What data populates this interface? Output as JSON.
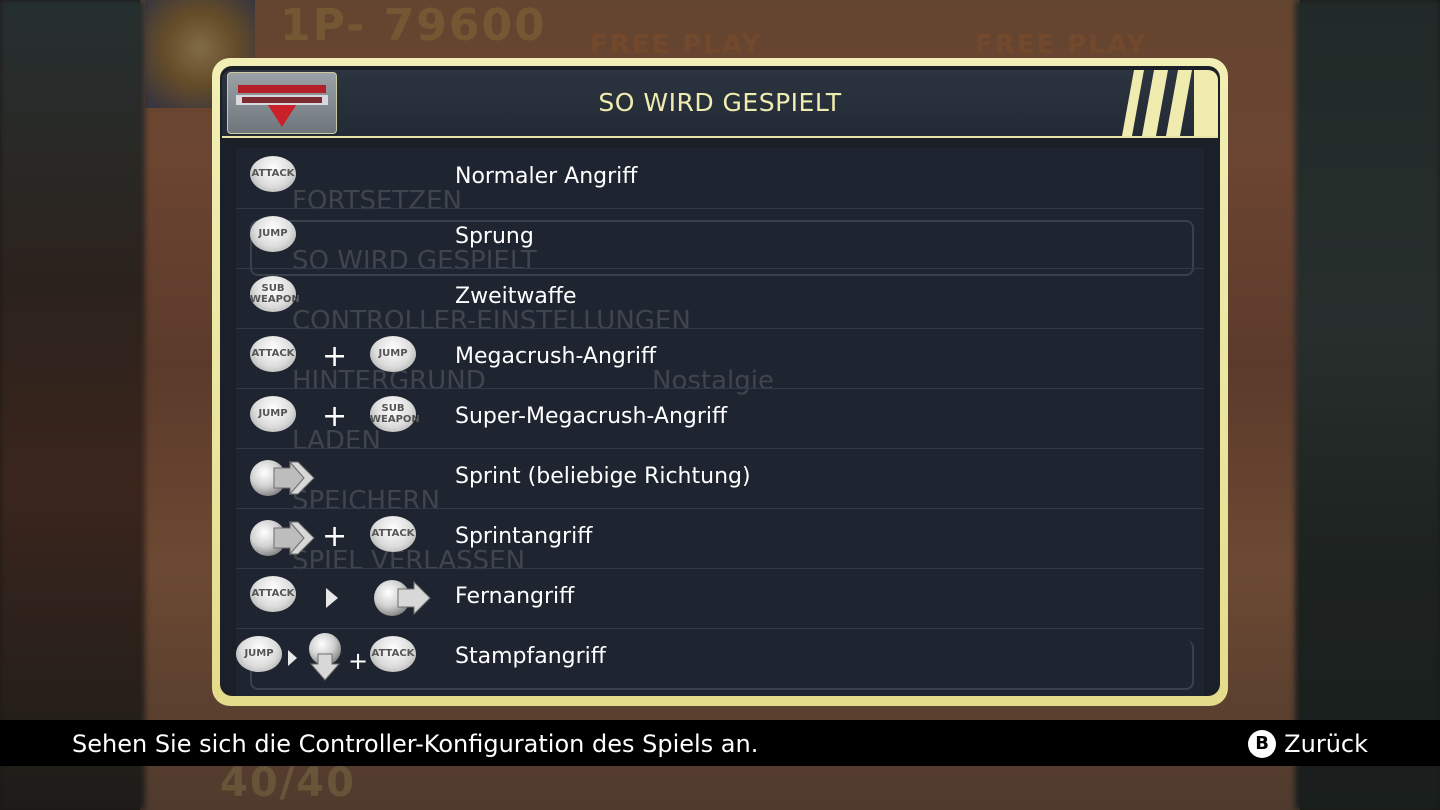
{
  "background": {
    "score": "1P-    79600",
    "free_play_1": "FREE PLAY",
    "free_play_2": "FREE PLAY",
    "ammo": "40/40",
    "ghost_menu": [
      "FORTSETZEN",
      "SO WIRD GESPIELT",
      "CONTROLLER-EINSTELLUNGEN",
      "HINTERGRUND",
      "LADEN",
      "SPEICHERN",
      "SPIEL VERLASSEN"
    ],
    "ghost_value": "Nostalgie"
  },
  "dialog": {
    "title": "SO WIRD GESPIELT",
    "logo_icon": "armored-warriors-logo",
    "accent_color": "#e8e3a4"
  },
  "buttons": {
    "attack": "ATTACK",
    "jump": "JUMP",
    "sub_weapon_line1": "SUB",
    "sub_weapon_line2": "WEAPON",
    "plus": "+"
  },
  "rows": [
    {
      "label": "Normaler Angriff"
    },
    {
      "label": "Sprung"
    },
    {
      "label": "Zweitwaffe"
    },
    {
      "label": "Megacrush-Angriff"
    },
    {
      "label": "Super-Megacrush-Angriff"
    },
    {
      "label": "Sprint (beliebige Richtung)"
    },
    {
      "label": "Sprintangriff"
    },
    {
      "label": "Fernangriff"
    },
    {
      "label": "Stampfangriff"
    }
  ],
  "footer": {
    "hint": "Sehen Sie sich die Controller-Konfiguration des Spiels an.",
    "back_button_glyph": "B",
    "back_label": "Zurück"
  }
}
